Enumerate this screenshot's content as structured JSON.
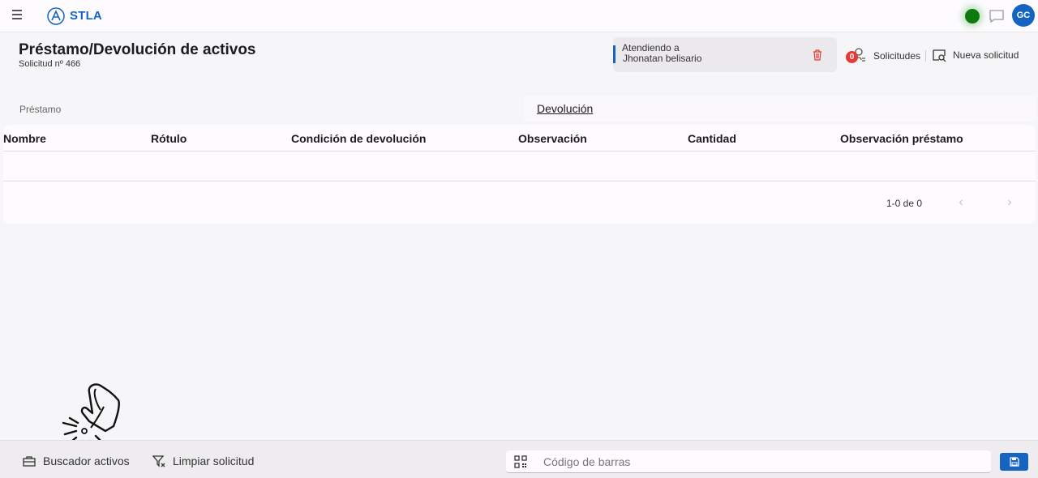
{
  "app": {
    "brand": "STLA",
    "avatar_initials": "GC",
    "status_color": "#0d7a0d",
    "accent": "#1565c0"
  },
  "header": {
    "title": "Préstamo/Devolución de activos",
    "subtitle": "Solicitud nº 466"
  },
  "attending": {
    "label": "Atendiendo a",
    "name": "Jhonatan belisario"
  },
  "actions": {
    "requests_count": "0",
    "requests_label": "Solicitudes",
    "new_request_label": "Nueva solicitud"
  },
  "tabs": [
    {
      "label": "Préstamo",
      "active": false
    },
    {
      "label": "Devolución",
      "active": true
    }
  ],
  "table": {
    "columns": [
      "Nombre",
      "Rótulo",
      "Condición de devolución",
      "Observación",
      "Cantidad",
      "Observación préstamo"
    ],
    "rows": [],
    "pagination": "1-0 de 0"
  },
  "bottom": {
    "asset_search_label": "Buscador activos",
    "clear_label": "Limpiar solicitud",
    "barcode_placeholder": "Código de barras"
  },
  "icons": {
    "menu": "menu-icon",
    "logo": "logo-icon",
    "chat": "chat-icon",
    "trash": "trash-icon",
    "requests": "requests-icon",
    "new_request": "new-request-icon",
    "briefcase": "briefcase-icon",
    "filter_clear": "filter-clear-icon",
    "qr": "qr-code-icon",
    "save": "save-icon",
    "cursor": "pointer-hand-icon"
  }
}
